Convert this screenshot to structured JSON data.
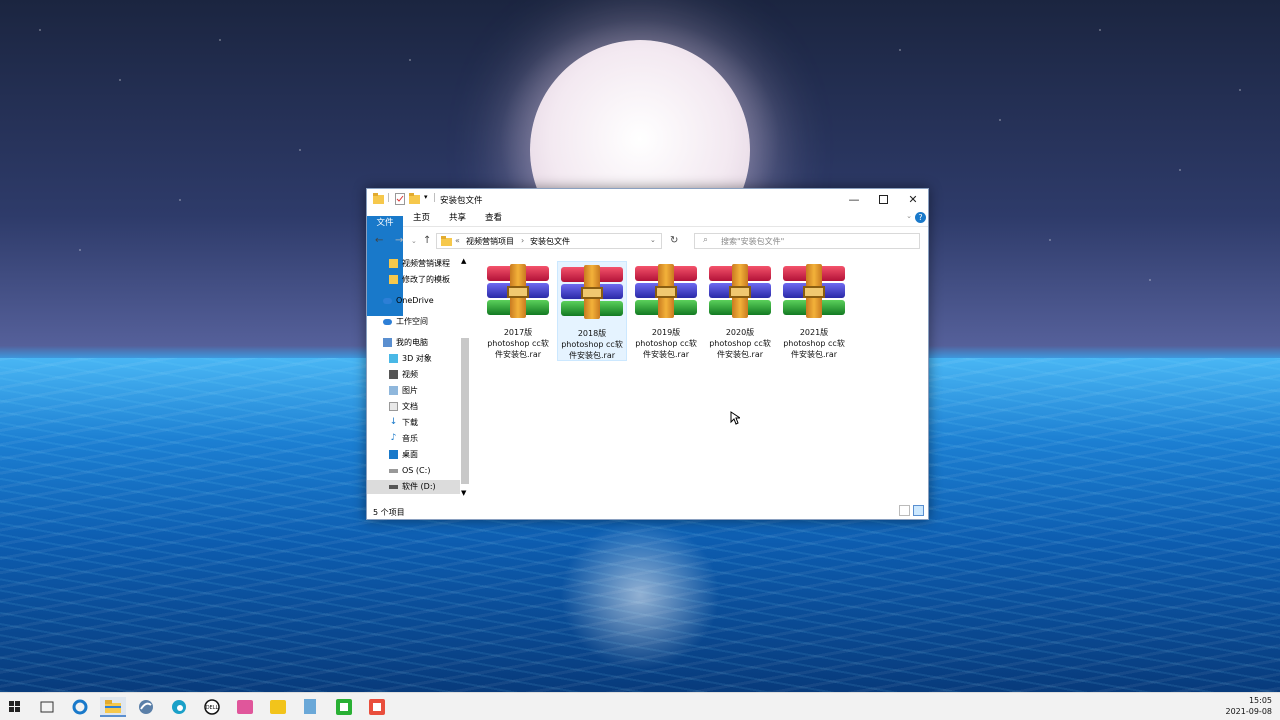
{
  "window": {
    "title": "安装包文件",
    "ribbon_tabs": [
      "文件",
      "主页",
      "共享",
      "查看"
    ],
    "breadcrumb": [
      "视频营销项目",
      "安装包文件"
    ],
    "breadcrumb_prefix": "«",
    "search_placeholder": "搜索\"安装包文件\"",
    "status": "5 个项目"
  },
  "nav_pane": [
    {
      "label": "视频营销课程",
      "icon": "folder-icon"
    },
    {
      "label": "修改了的模板",
      "icon": "folder-icon"
    },
    {
      "label": "OneDrive",
      "icon": "cloud-icon"
    },
    {
      "label": "工作空间",
      "icon": "cloud-icon"
    },
    {
      "label": "我的电脑",
      "icon": "computer-icon"
    },
    {
      "label": "3D 对象",
      "icon": "cube-icon"
    },
    {
      "label": "视频",
      "icon": "video-icon"
    },
    {
      "label": "图片",
      "icon": "picture-icon"
    },
    {
      "label": "文档",
      "icon": "document-icon"
    },
    {
      "label": "下载",
      "icon": "download-icon"
    },
    {
      "label": "音乐",
      "icon": "music-icon"
    },
    {
      "label": "桌面",
      "icon": "desktop-icon"
    },
    {
      "label": "OS (C:)",
      "icon": "drive-icon"
    },
    {
      "label": "软件 (D:)",
      "icon": "drive-icon"
    }
  ],
  "files": [
    {
      "line1": "2017版",
      "line2": "photoshop cc软",
      "line3": "件安装包.rar"
    },
    {
      "line1": "2018版",
      "line2": "photoshop cc软",
      "line3": "件安装包.rar"
    },
    {
      "line1": "2019版",
      "line2": "photoshop cc软",
      "line3": "件安装包.rar"
    },
    {
      "line1": "2020版",
      "line2": "photoshop cc软",
      "line3": "件安装包.rar"
    },
    {
      "line1": "2021版",
      "line2": "photoshop cc软",
      "line3": "件安装包.rar"
    }
  ],
  "taskbar": {
    "time": "15:05",
    "date": "2021-09-08",
    "apps": [
      "start-icon",
      "task-view-icon",
      "search-app-icon",
      "file-explorer-icon",
      "browser-icon",
      "edge-icon",
      "dell-icon",
      "image-app-icon",
      "notes-app-icon",
      "writer-app-icon",
      "camtasia-icon",
      "recorder-icon"
    ]
  },
  "colors": {
    "accent": "#1979ca",
    "selection": "#e5f3ff"
  }
}
